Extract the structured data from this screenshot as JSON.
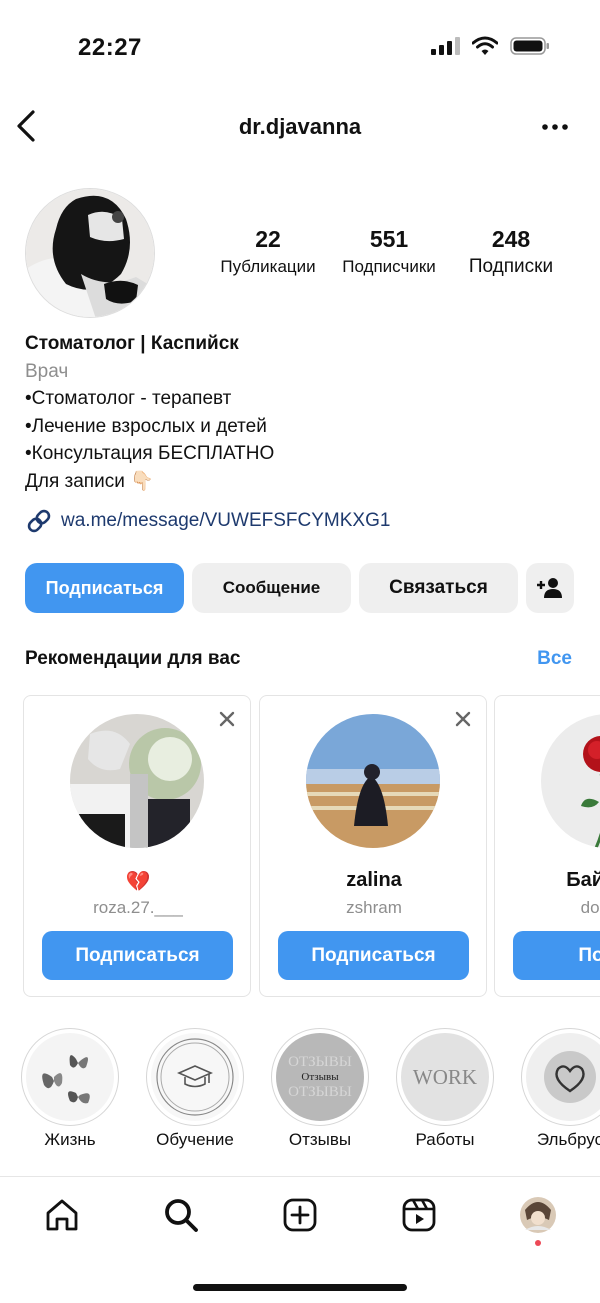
{
  "status_bar": {
    "time": "22:27"
  },
  "header": {
    "username": "dr.djavanna"
  },
  "stats": [
    {
      "value": "22",
      "label": "Публикации"
    },
    {
      "value": "551",
      "label": "Подписчики"
    },
    {
      "value": "248",
      "label": "Подписки"
    }
  ],
  "bio": {
    "name": "Стоматолог | Каспийск",
    "category": "Врач",
    "lines": [
      "•Стоматолог - терапевт",
      "•Лечение взрослых и детей",
      "•Консультация БЕСПЛАТНО",
      "Для записи 👇🏻"
    ],
    "link": "wa.me/message/VUWEFSFCYMKXG1"
  },
  "actions": {
    "follow": "Подписаться",
    "message": "Сообщение",
    "contact": "Связаться"
  },
  "suggestions": {
    "title": "Рекомендации для вас",
    "see_all": "Все",
    "cards": [
      {
        "name": "💔",
        "username": "roza.27.___",
        "button": "Подписаться"
      },
      {
        "name": "zalina",
        "username": "zshram",
        "button": "Подписаться"
      },
      {
        "name": "Байраво",
        "username": "doctor_",
        "button": "Подпи"
      }
    ]
  },
  "highlights": [
    {
      "label": "Жизнь"
    },
    {
      "label": "Обучение"
    },
    {
      "label": "Отзывы",
      "cover_text": "ОТЗЫВЫ",
      "cover_center": "Отзывы"
    },
    {
      "label": "Работы",
      "cover_text": "WORK"
    },
    {
      "label": "Эльбрус"
    }
  ],
  "colors": {
    "accent": "#4196f0",
    "link": "#1e3a6e",
    "muted": "#8e8e8e",
    "badge": "#ed4956"
  },
  "icons": [
    "back-arrow-icon",
    "more-icon",
    "link-icon",
    "add-person-icon",
    "close-icon",
    "home-icon",
    "search-icon",
    "create-icon",
    "reels-icon",
    "profile-avatar-icon"
  ]
}
